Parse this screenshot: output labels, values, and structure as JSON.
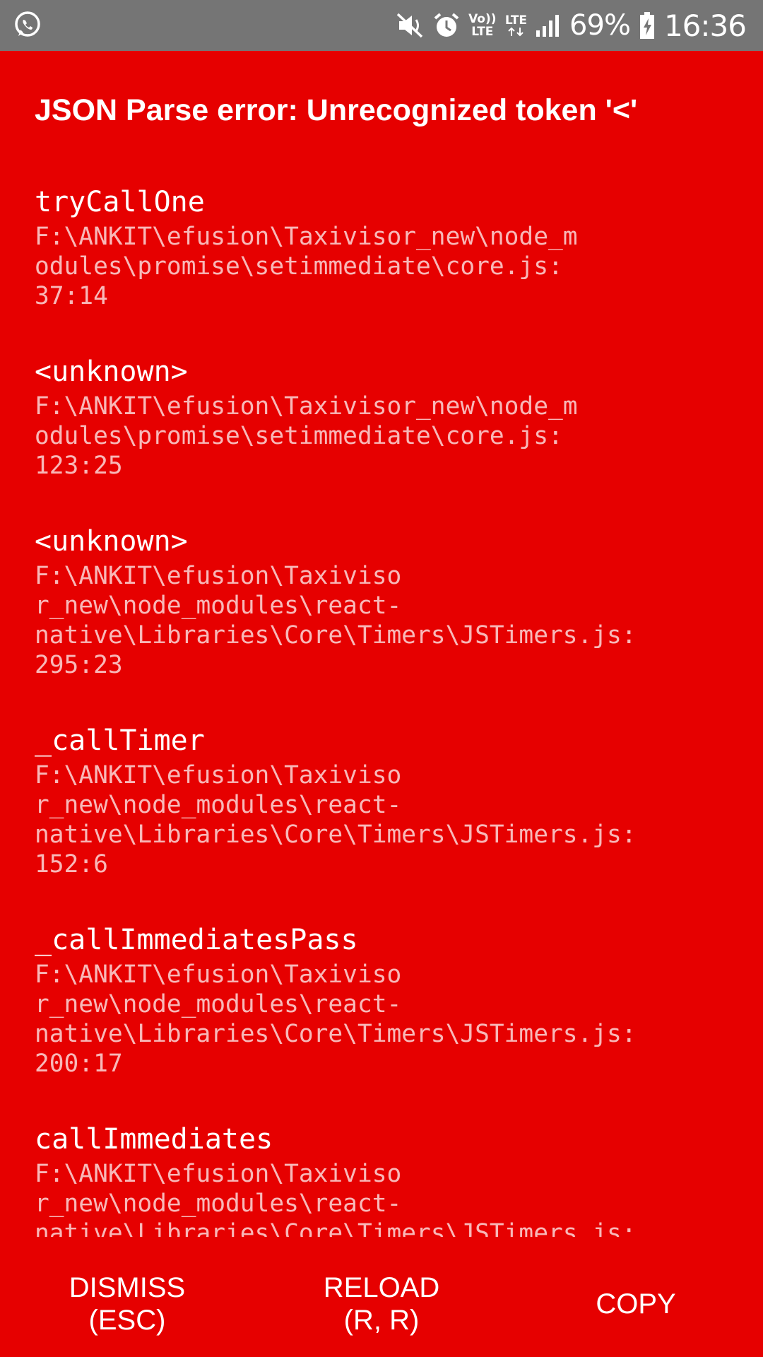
{
  "status_bar": {
    "app_icon": "whatsapp-icon",
    "icons": [
      "mute-icon",
      "alarm-icon",
      "volte-icon",
      "lte-icon",
      "signal-icon"
    ],
    "volte_label": "Vo)) LTE",
    "lte_label": "LTE",
    "battery_percent": "69%",
    "battery_icon": "battery-charging-icon",
    "time": "16:36",
    "background": "#757575"
  },
  "error": {
    "title": "JSON Parse error: Unrecognized token '<'",
    "background": "#e60000"
  },
  "stack": [
    {
      "method": "tryCallOne",
      "file": "F:\\ANKIT\\efusion\\Taxivisor_new\\node_m\nodules\\promise\\setimmediate\\core.js:\n37:14"
    },
    {
      "method": "<unknown>",
      "file": "F:\\ANKIT\\efusion\\Taxivisor_new\\node_m\nodules\\promise\\setimmediate\\core.js:\n123:25"
    },
    {
      "method": "<unknown>",
      "file": "F:\\ANKIT\\efusion\\Taxiviso\nr_new\\node_modules\\react-\nnative\\Libraries\\Core\\Timers\\JSTimers.js:\n295:23"
    },
    {
      "method": "_callTimer",
      "file": "F:\\ANKIT\\efusion\\Taxiviso\nr_new\\node_modules\\react-\nnative\\Libraries\\Core\\Timers\\JSTimers.js:\n152:6"
    },
    {
      "method": "_callImmediatesPass",
      "file": "F:\\ANKIT\\efusion\\Taxiviso\nr_new\\node_modules\\react-\nnative\\Libraries\\Core\\Timers\\JSTimers.js:\n200:17"
    },
    {
      "method": "callImmediates",
      "file": "F:\\ANKIT\\efusion\\Taxiviso\nr_new\\node_modules\\react-\nnative\\Libraries\\Core\\Timers\\JSTimers.js:"
    }
  ],
  "footer": {
    "dismiss_label": "DISMISS\n(ESC)",
    "reload_label": "RELOAD\n(R, R)",
    "copy_label": "COPY"
  }
}
